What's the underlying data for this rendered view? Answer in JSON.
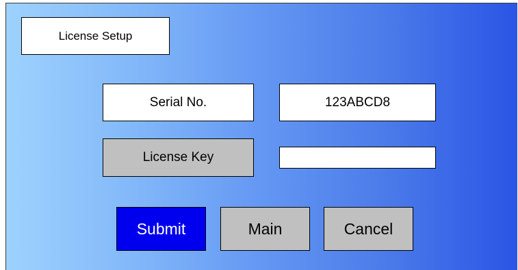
{
  "header": {
    "title": "License Setup"
  },
  "form": {
    "serial_label": "Serial No.",
    "serial_value": "123ABCD8",
    "license_label": "License Key",
    "license_value": ""
  },
  "buttons": {
    "submit": "Submit",
    "main": "Main",
    "cancel": "Cancel"
  },
  "colors": {
    "submit_bg": "#0000ee",
    "button_bg": "#c0c0c0",
    "gradient_start": "#9ed2fd",
    "gradient_end": "#2a55e6"
  }
}
